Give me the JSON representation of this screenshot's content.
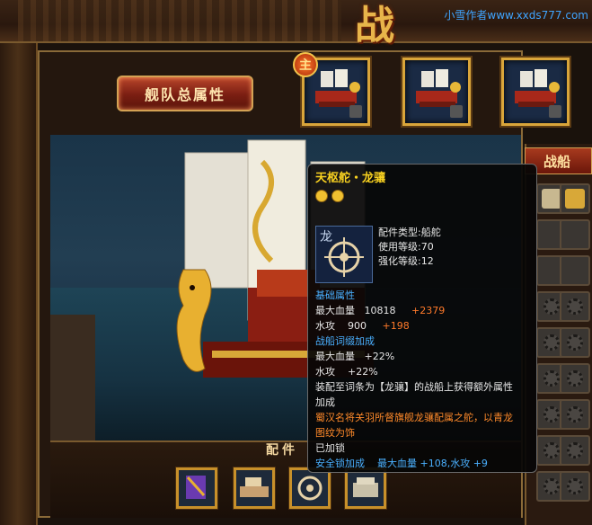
{
  "banner": {
    "title": "战",
    "watermark": "小雪作者www.xxds777.com"
  },
  "fleet_button": "舰队总属性",
  "main_badge": "主",
  "right_panel": {
    "header": "战船"
  },
  "parts": {
    "title": "配件"
  },
  "tooltip": {
    "name": "天枢舵・龙骧",
    "meta": {
      "type": "配件类型:船舵",
      "use_level": "使用等级:70",
      "enhance_level": "强化等级:12"
    },
    "base_section": "基础属性",
    "base_rows": [
      {
        "label": "最大血量",
        "value": "10818",
        "bonus": "+2379"
      },
      {
        "label": "水攻",
        "value": "900",
        "bonus": "+198"
      }
    ],
    "affix_section": "战船词缀加成",
    "affix_rows": [
      {
        "label": "最大血量",
        "bonus": "+22%"
      },
      {
        "label": "水攻",
        "bonus": "+22%"
      }
    ],
    "equip_note_line1": "装配至词条为【龙骧】的战船上获得额外属性",
    "equip_note_line2": "加成",
    "lore_line1": "蜀汉名将关羽所督旗舰龙骧配属之舵，以青龙",
    "lore_line2": "图纹为饰",
    "locked_text": "已加锁",
    "safety_label": "安全锁加成",
    "safety_value": "最大血量 +108,水攻 +9"
  },
  "colors": {
    "gold": "#d9a53a",
    "tooltip_title": "#f7d020",
    "tooltip_section": "#4ab0ff",
    "tooltip_bonus": "#ff7a2a"
  }
}
